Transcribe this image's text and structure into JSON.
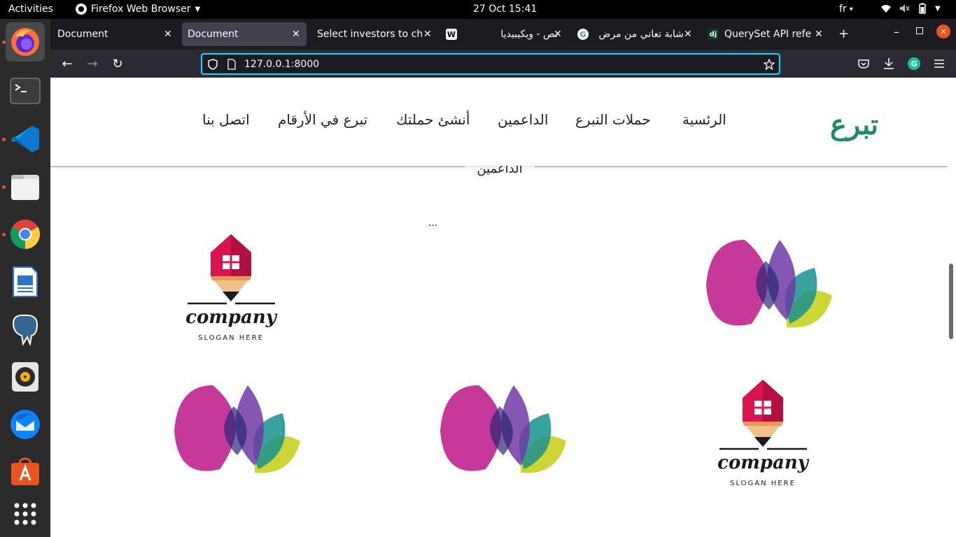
{
  "topbar": {
    "activities": "Activities",
    "app_name": "Firefox Web Browser",
    "clock": "27 Oct  15:41",
    "lang": "fr"
  },
  "dock": {
    "items": [
      {
        "name": "firefox-icon",
        "running": true
      },
      {
        "name": "terminal-icon",
        "running": false
      },
      {
        "name": "vscode-icon",
        "running": true
      },
      {
        "name": "files-icon",
        "running": true
      },
      {
        "name": "chrome-icon",
        "running": true
      },
      {
        "name": "libreoffice-writer-icon",
        "running": false
      },
      {
        "name": "pgadmin-elephant-icon",
        "running": false
      },
      {
        "name": "rhythmbox-icon",
        "running": false
      },
      {
        "name": "thunderbird-icon",
        "running": false
      },
      {
        "name": "software-center-icon",
        "running": false
      },
      {
        "name": "show-apps-icon",
        "running": false
      }
    ]
  },
  "tabs": [
    {
      "title": "Document",
      "favicon": "",
      "active": false
    },
    {
      "title": "Document",
      "favicon": "",
      "active": true
    },
    {
      "title": "Select investors to cha",
      "favicon": "",
      "active": false
    },
    {
      "title": "نص - ويكيبيديا",
      "favicon": "wikipedia",
      "active": false
    },
    {
      "title": "شابة تعاني من مرض",
      "favicon": "google",
      "active": false
    },
    {
      "title": "QuerySet API refere",
      "favicon": "django",
      "active": false
    }
  ],
  "navbar": {
    "url": "127.0.0.1:8000"
  },
  "site": {
    "logo": "تبرع",
    "nav": [
      "الرئسية",
      "حملات التبرع",
      "الداعمين",
      "أنشئ حملتك",
      "تبرع في الأرقام",
      "اتصل بنا"
    ],
    "section_title": "الداعمين",
    "ellipsis": "...",
    "logos": [
      {
        "type": "company",
        "text": "company",
        "slogan": "SLOGAN HERE"
      },
      {
        "type": "petals"
      },
      {
        "type": "petals"
      },
      {
        "type": "petals"
      },
      {
        "type": "company",
        "text": "company",
        "slogan": "SLOGAN HERE"
      }
    ]
  },
  "colors": {
    "accent": "#1d8a6b",
    "url_focus": "#00ddff",
    "ubuntu_orange": "#e95420"
  }
}
